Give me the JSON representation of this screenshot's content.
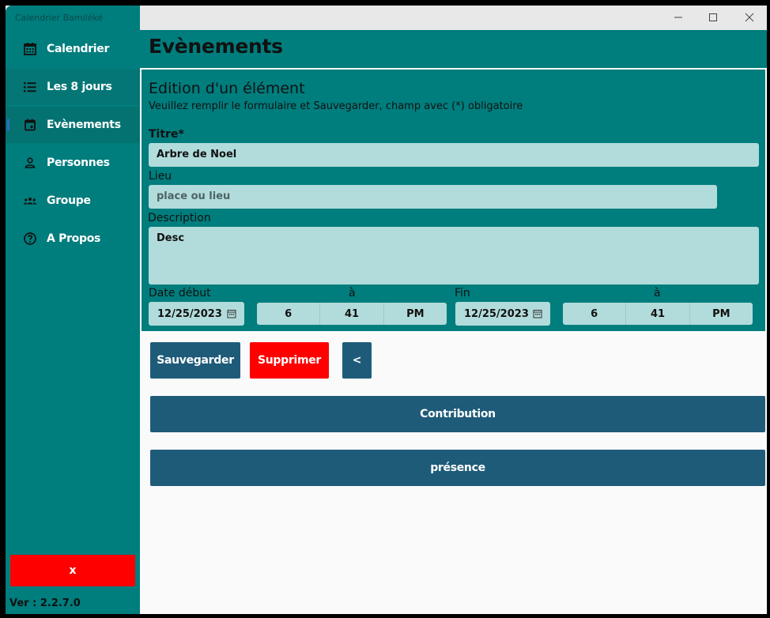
{
  "app": {
    "title": "Calendrier Bamiléké",
    "version": "Ver : 2.2.7.0"
  },
  "sidebar": {
    "items": [
      {
        "label": "Calendrier",
        "icon": "calendar-grid-icon"
      },
      {
        "label": "Les 8  jours",
        "icon": "list-icon"
      },
      {
        "label": "Evènements",
        "icon": "event-icon"
      },
      {
        "label": "Personnes",
        "icon": "person-icon"
      },
      {
        "label": "Groupe",
        "icon": "group-icon"
      },
      {
        "label": "A Propos",
        "icon": "help-icon"
      }
    ],
    "close_label": "x"
  },
  "header": {
    "title": "Evènements"
  },
  "form": {
    "title": "Edition d'un élément",
    "subtitle": "Veuillez remplir le formulaire et Sauvegarder, champ avec (*) obligatoire",
    "titre": {
      "label": "Titre*",
      "value": "Arbre de Noel"
    },
    "lieu": {
      "label": "Lieu",
      "placeholder": "place ou lieu",
      "value": ""
    },
    "description": {
      "label": "Description",
      "value": "Desc"
    },
    "date_debut": {
      "label": "Date début",
      "date": "12/25/2023",
      "a_label": "à",
      "hour": "6",
      "minute": "41",
      "ampm": "PM"
    },
    "fin": {
      "label": "Fin",
      "date": "12/25/2023",
      "a_label": "à",
      "hour": "6",
      "minute": "41",
      "ampm": "PM"
    }
  },
  "actions": {
    "save": "Sauvegarder",
    "delete": "Supprimer",
    "back": "<",
    "contribution": "Contribution",
    "presence": "présence"
  },
  "colors": {
    "teal": "#007d7d",
    "field": "#b1dcdb",
    "button": "#1e5b79",
    "danger": "#ff0000"
  }
}
